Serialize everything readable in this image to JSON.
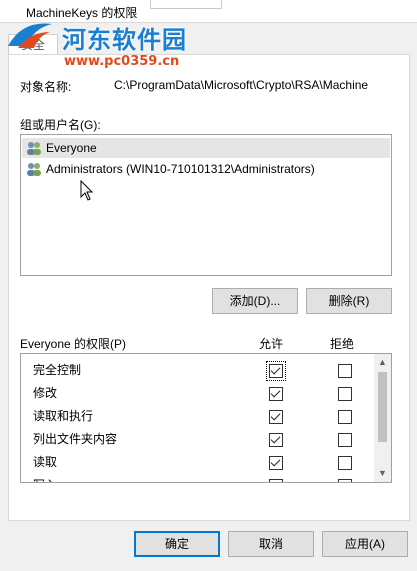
{
  "window": {
    "title": "MachineKeys 的权限"
  },
  "tab": {
    "label": "安全"
  },
  "watermark": {
    "brand": "河东软件园",
    "url": "www.pc0359.cn"
  },
  "object": {
    "label": "对象名称:",
    "value": "C:\\ProgramData\\Microsoft\\Crypto\\RSA\\Machine"
  },
  "groups": {
    "label": "组或用户名(G):",
    "items": [
      {
        "name": "Everyone",
        "selected": true
      },
      {
        "name": "Administrators (WIN10-710101312\\Administrators)",
        "selected": false
      }
    ]
  },
  "buttons": {
    "add": "添加(D)...",
    "remove": "删除(R)",
    "ok": "确定",
    "cancel": "取消",
    "apply": "应用(A)"
  },
  "permissions": {
    "label": "Everyone 的权限(P)",
    "allow_header": "允许",
    "deny_header": "拒绝",
    "rows": [
      {
        "name": "完全控制",
        "allow": true,
        "deny": false
      },
      {
        "name": "修改",
        "allow": true,
        "deny": false
      },
      {
        "name": "读取和执行",
        "allow": true,
        "deny": false
      },
      {
        "name": "列出文件夹内容",
        "allow": true,
        "deny": false
      },
      {
        "name": "读取",
        "allow": true,
        "deny": false
      },
      {
        "name": "写入",
        "allow": true,
        "deny": false
      }
    ]
  },
  "colors": {
    "accent": "#0078d7",
    "selection": "#e5e5e5",
    "watermark_blue": "#1a7fd0",
    "watermark_orange": "#e34a1b"
  }
}
